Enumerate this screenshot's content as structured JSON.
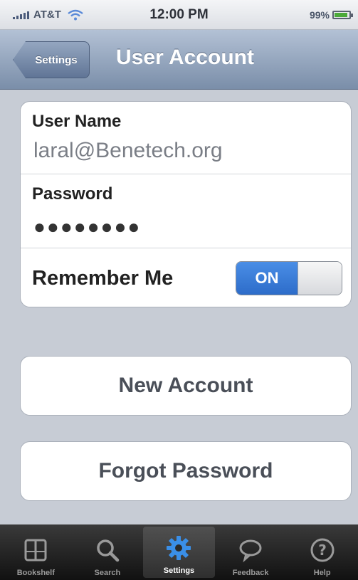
{
  "status_bar": {
    "carrier": "AT&T",
    "time": "12:00 PM",
    "battery": "99%"
  },
  "nav": {
    "back_label": "Settings",
    "title": "User Account"
  },
  "form": {
    "username_label": "User Name",
    "username_value": "laral@Benetech.org",
    "password_label": "Password",
    "password_value": "●●●●●●●●",
    "remember_label": "Remember Me",
    "remember_toggle_label": "ON"
  },
  "buttons": {
    "new_account": "New Account",
    "forgot_password": "Forgot Password"
  },
  "tabs": [
    {
      "label": "Bookshelf",
      "icon": "book-icon"
    },
    {
      "label": "Search",
      "icon": "search-icon"
    },
    {
      "label": "Settings",
      "icon": "gear-icon",
      "selected": true
    },
    {
      "label": "Feedback",
      "icon": "speech-bubble-icon"
    },
    {
      "label": "Help",
      "icon": "help-icon"
    }
  ],
  "colors": {
    "nav_bar": "#7a8ea9",
    "toggle_on": "#2d6cc9",
    "background": "#c7ccd5"
  }
}
